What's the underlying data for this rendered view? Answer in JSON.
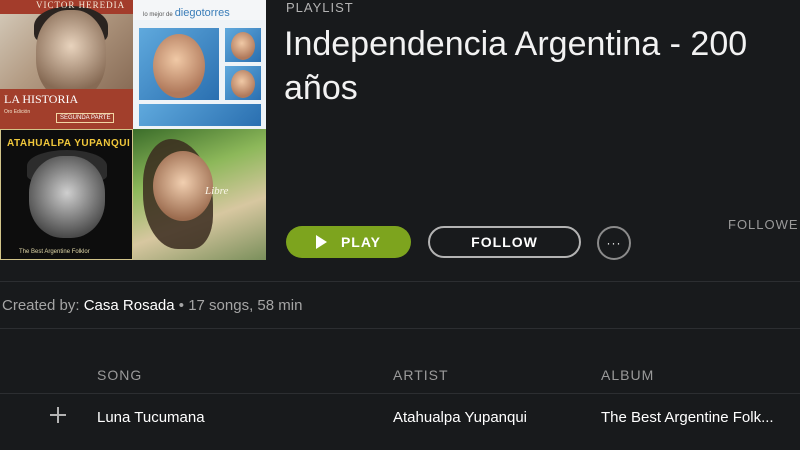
{
  "header": {
    "type_label": "PLAYLIST",
    "title": "Independencia Argentina - 200 años",
    "followers_label": "FOLLOWE"
  },
  "covers": [
    {
      "top_text": "VICTOR HEREDIA",
      "main_text": "LA HISTORIA",
      "sub_text": "Oro Edición",
      "tag": "SEGUNDA PARTE"
    },
    {
      "brand": "diegotorres",
      "small": "lo mejor de"
    },
    {
      "title": "ATAHUALPA YUPANQUI",
      "footer": "The Best Argentine Folklor"
    },
    {
      "cursive": "Libre"
    }
  ],
  "actions": {
    "play_label": "PLAY",
    "follow_label": "FOLLOW",
    "more_label": "···"
  },
  "meta": {
    "created_by_label": "Created by:",
    "owner": "Casa Rosada",
    "stats": "• 17 songs, 58 min"
  },
  "table": {
    "columns": {
      "song": "SONG",
      "artist": "ARTIST",
      "album": "ALBUM"
    },
    "rows": [
      {
        "song": "Luna Tucumana",
        "artist": "Atahualpa Yupanqui",
        "album": "The Best Argentine Folk..."
      }
    ]
  },
  "colors": {
    "play_green": "#7da41e",
    "background": "#181a1c"
  }
}
